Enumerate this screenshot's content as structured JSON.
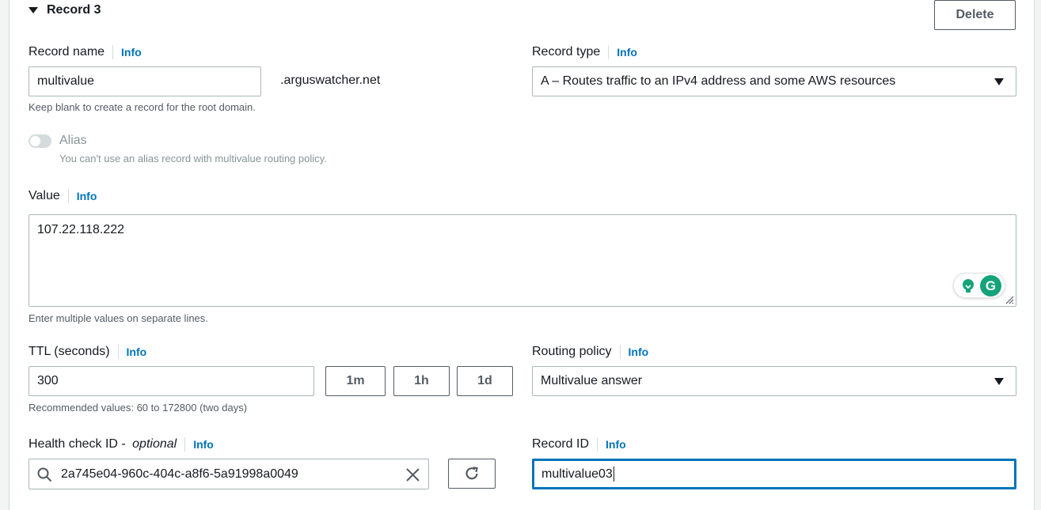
{
  "record": {
    "header": "Record 3",
    "delete_label": "Delete"
  },
  "record_name": {
    "label": "Record name",
    "info": "Info",
    "value": "multivalue",
    "domain_suffix": ".arguswatcher.net",
    "hint": "Keep blank to create a record for the root domain."
  },
  "record_type": {
    "label": "Record type",
    "info": "Info",
    "selected": "A – Routes traffic to an IPv4 address and some AWS resources"
  },
  "alias": {
    "label": "Alias",
    "description": "You can't use an alias record with multivalue routing policy.",
    "enabled": false
  },
  "value": {
    "label": "Value",
    "info": "Info",
    "text": "107.22.118.222",
    "hint": "Enter multiple values on separate lines."
  },
  "ttl": {
    "label": "TTL (seconds)",
    "info": "Info",
    "value": "300",
    "presets": [
      "1m",
      "1h",
      "1d"
    ],
    "hint": "Recommended values: 60 to 172800 (two days)"
  },
  "routing_policy": {
    "label": "Routing policy",
    "info": "Info",
    "selected": "Multivalue answer"
  },
  "health_check": {
    "label": "Health check ID - ",
    "label_optional": "optional",
    "info": "Info",
    "value": "2a745e04-960c-404c-a8f6-5a91998a0049"
  },
  "record_id": {
    "label": "Record ID",
    "info": "Info",
    "value": "multivalue03"
  },
  "grammarly": {
    "logo_letter": "G"
  },
  "colors": {
    "link": "#0073bb",
    "border": "#aab7b8",
    "focus": "#0073bb",
    "grammarly": "#15a37a"
  }
}
